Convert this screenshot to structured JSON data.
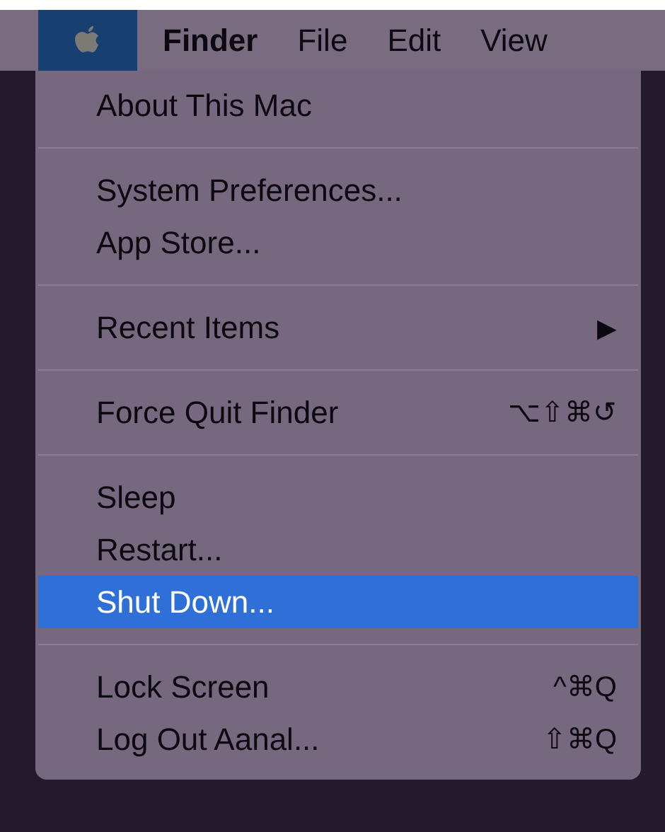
{
  "menu_bar": [
    {
      "kind": "apple",
      "selected": true
    },
    {
      "kind": "app",
      "label": "Finder",
      "selected": false
    },
    {
      "kind": "menu",
      "label": "File",
      "selected": false
    },
    {
      "kind": "menu",
      "label": "Edit",
      "selected": false
    },
    {
      "kind": "menu",
      "label": "View",
      "selected": false
    }
  ],
  "menu": {
    "sections": [
      [
        {
          "label": "About This Mac",
          "selected": false
        }
      ],
      [
        {
          "label": "System Preferences...",
          "selected": false
        },
        {
          "label": "App Store...",
          "selected": false
        }
      ],
      [
        {
          "label": "Recent Items",
          "submenu": "▶",
          "selected": false
        }
      ],
      [
        {
          "label": "Force Quit Finder",
          "shortcut": "⌥⇧⌘↺",
          "selected": false
        }
      ],
      [
        {
          "label": "Sleep",
          "selected": false
        },
        {
          "label": "Restart...",
          "selected": false
        },
        {
          "label": "Shut Down...",
          "selected": true
        }
      ],
      [
        {
          "label": "Lock Screen",
          "shortcut": "^⌘Q",
          "selected": false
        },
        {
          "label": "Log Out Aanal...",
          "shortcut": "⇧⌘Q",
          "selected": false
        }
      ]
    ]
  }
}
